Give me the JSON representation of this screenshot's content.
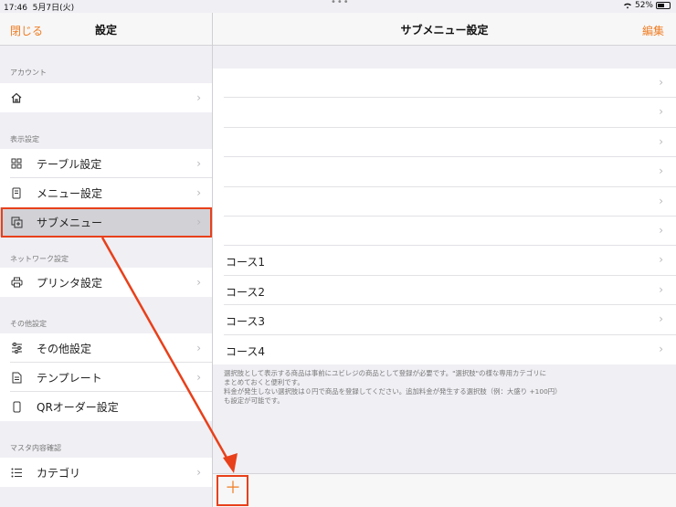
{
  "status": {
    "time": "17:46",
    "date": "5月7日(火)",
    "battery": "52%"
  },
  "left": {
    "close_label": "閉じる",
    "title": "設定",
    "sections": [
      {
        "header": "アカウント",
        "items": [
          {
            "label": "",
            "icon": "home-icon"
          }
        ]
      },
      {
        "header": "表示設定",
        "items": [
          {
            "label": "テーブル設定",
            "icon": "grid-icon"
          },
          {
            "label": "メニュー設定",
            "icon": "menu-book-icon"
          },
          {
            "label": "サブメニュー",
            "icon": "submenu-icon"
          }
        ]
      },
      {
        "header": "ネットワーク設定",
        "items": [
          {
            "label": "プリンタ設定",
            "icon": "printer-icon"
          }
        ]
      },
      {
        "header": "その他設定",
        "items": [
          {
            "label": "その他設定",
            "icon": "sliders-icon"
          },
          {
            "label": "テンプレート",
            "icon": "document-icon"
          },
          {
            "label": "QRオーダー設定",
            "icon": "phone-icon"
          }
        ]
      },
      {
        "header": "マスタ内容確認",
        "items": [
          {
            "label": "カテゴリ",
            "icon": "list-icon"
          }
        ]
      }
    ]
  },
  "right": {
    "title": "サブメニュー設定",
    "edit_label": "編集",
    "rows": [
      "",
      "",
      "",
      "",
      "",
      "",
      "コース1",
      "コース2",
      "コース3",
      "コース4"
    ],
    "note": [
      "選択肢として表示する商品は事前にユビレジの商品として登録が必要です。\"選択肢\"の様な専用カテゴリに",
      "まとめておくと便利です。",
      "料金が発生しない選択肢は０円で商品を登録してください。追加料金が発生する選択肢（例：大盛り +100円）",
      "も設定が可能です。"
    ],
    "add_label": "＋"
  },
  "colors": {
    "accent": "#ef7d22",
    "annotation": "#e8401a",
    "selected_row": "#d1d1d6"
  }
}
